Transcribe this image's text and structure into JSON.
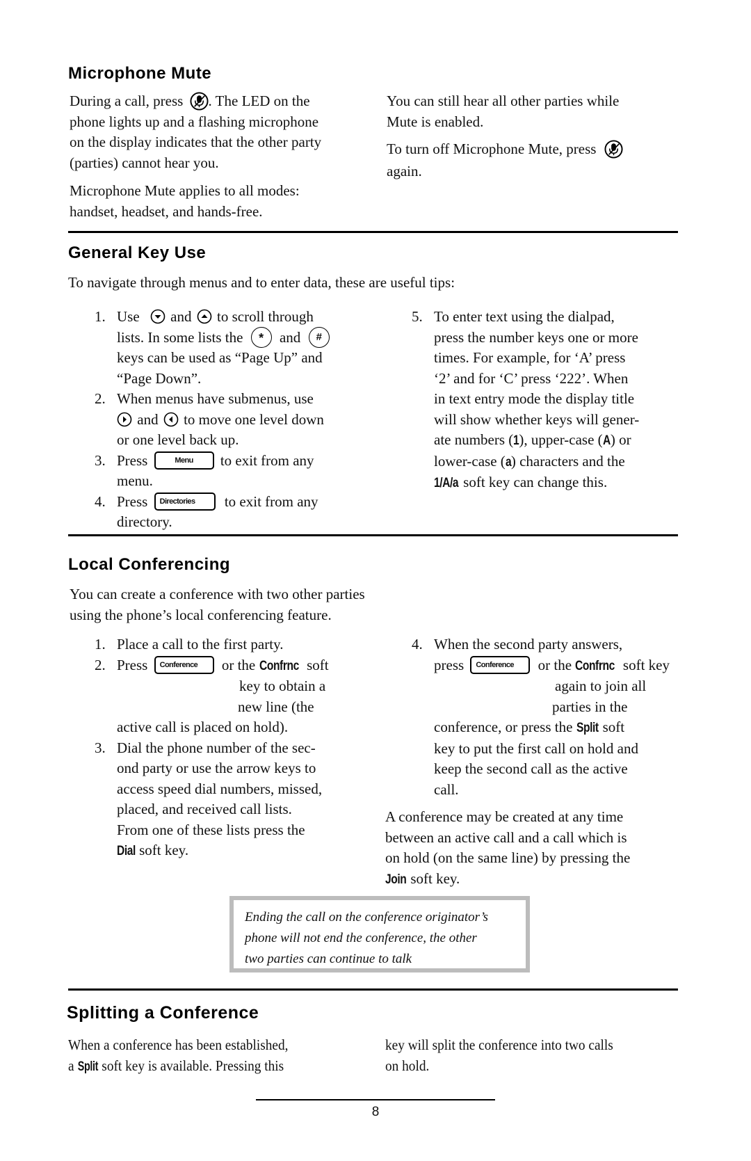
{
  "page_number": "8",
  "sections": {
    "mute": {
      "title": "Microphone Mute",
      "p1_a": "During a call, press",
      "p1_b": ".  The LED on the",
      "p1_l2": "phone lights up and a flashing microphone",
      "p1_l3": "on the display indicates that the other party",
      "p1_l4": "(parties) cannot hear you.",
      "p2_l1": "Microphone Mute applies to all modes:",
      "p2_l2": "handset, headset, and hands-free.",
      "r1_l1": "You can still hear all other parties while",
      "r1_l2": "Mute is enabled.",
      "r2_a": "To turn off Microphone Mute, press",
      "r2_l2": "again.",
      "icon": "mute-microphone-icon"
    },
    "keys": {
      "title": "General Key Use",
      "intro": "To navigate through menus and to enter data, these are useful tips:",
      "i1_num": "1.",
      "i1_a": "Use",
      "i1_b": "and",
      "i1_c": "to scroll through",
      "i1_l2a": "lists.  In some lists the",
      "i1_l2b": "and",
      "i1_l3": "keys can be used as “Page Up” and",
      "i1_l4": "“Page Down”.",
      "star": "*",
      "hash": "#",
      "i2_num": "2.",
      "i2_l1": "When menus have submenus, use",
      "i2_l2a": "and",
      "i2_l2b": "to move one level down",
      "i2_l3": "or one level back up.",
      "i3_num": "3.",
      "i3_a": "Press",
      "i3_key": "Menu",
      "i3_b": "to exit from any",
      "i3_l2": "menu.",
      "i4_num": "4.",
      "i4_a": "Press",
      "i4_key": "Directories",
      "i4_b": "to exit from any",
      "i4_l2": "directory.",
      "i5_num": "5.",
      "i5_l1": "To enter text using the dialpad,",
      "i5_l2": "press the number keys one or more",
      "i5_l3": "times.  For example, for ‘A’ press",
      "i5_l4": "‘2’ and for ‘C’ press ‘222’.  When",
      "i5_l5": "in text entry mode the display title",
      "i5_l6": "will show whether keys will gener-",
      "i5_l7a": "ate numbers (",
      "i5_l7_num": "1",
      "i5_l7b": "), upper-case (",
      "i5_l7_up": "A",
      "i5_l7c": ") or",
      "i5_l8a": "lower-case (",
      "i5_l8_low": "a",
      "i5_l8b": ") characters and the",
      "i5_l9_key": "1/A/a",
      "i5_l9b": " soft key can change this."
    },
    "conf": {
      "title": "Local Conferencing",
      "intro_l1": "You can create a conference with two other parties",
      "intro_l2": "using the phone’s local conferencing feature.",
      "i1_num": "1.",
      "i1": "Place a call to the first party.",
      "i2_num": "2.",
      "i2_a": "Press",
      "key": "Conference",
      "i2_b": "or the",
      "softkey_confrnc": "Confrnc",
      "i2_c": "soft",
      "i2_l2": "key to obtain a",
      "i2_l3": "new line (the",
      "i2_l4": "active call is placed on hold).",
      "i3_num": "3.",
      "i3_l1": "Dial the phone number of the sec-",
      "i3_l2": "ond party or use the arrow keys to",
      "i3_l3": "access speed dial numbers, missed,",
      "i3_l4": "placed, and received call lists.",
      "i3_l5": "From one of these lists press the",
      "softkey_dial": "Dial",
      "i3_l6b": " soft key.",
      "i4_num": "4.",
      "i4_l1": "When the second party answers,",
      "i4_a": "press",
      "i4_b": "or the",
      "i4_c": "soft key",
      "i4_l2": "again to join all",
      "i4_l3": "parties in the",
      "i4_l4a": "conference, or press the",
      "softkey_split": "Split",
      "i4_l4b": " soft",
      "i4_l5": "key to put the first call on hold and",
      "i4_l6": "keep the second call as the active",
      "i4_l7": "call.",
      "p_l1": "A conference may be created at any time",
      "p_l2": "between an active call and a call which is",
      "p_l3": "on hold (on the same line) by pressing the",
      "softkey_join": "Join",
      "p_l4b": " soft key.",
      "note_l1": "Ending the call on the conference originator’s",
      "note_l2": "phone will not end the conference, the other",
      "note_l3": "two parties can continue to talk"
    },
    "split": {
      "title": "Splitting a Conference",
      "l1": "When a conference has been established,",
      "l2a": "a ",
      "softkey_split": "Split",
      "l2b": " soft key is available.  Pressing this",
      "r1": "key will split the conference into two calls",
      "r2": "on hold."
    }
  }
}
